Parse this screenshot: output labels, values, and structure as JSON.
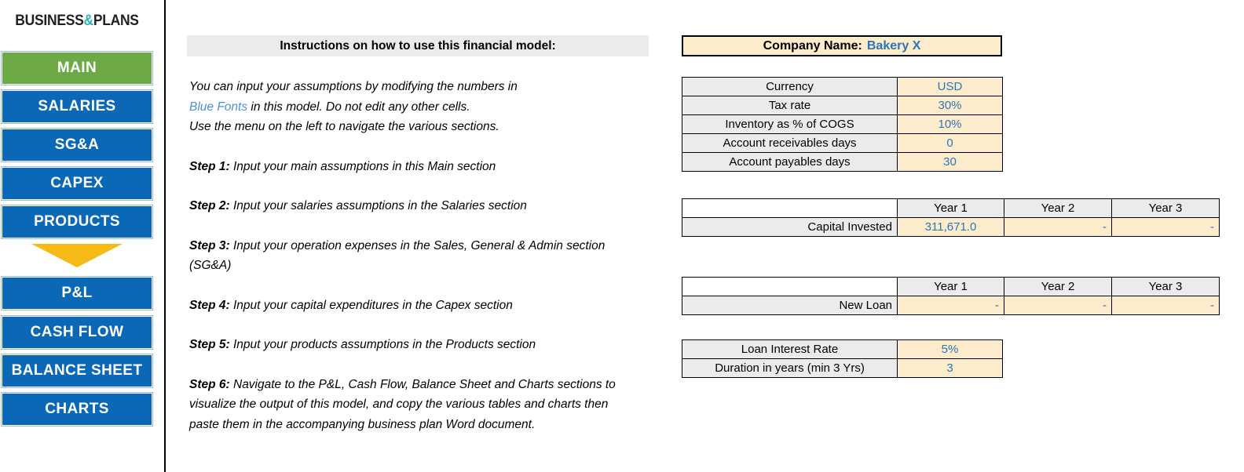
{
  "sidebar": {
    "logo": {
      "part1": "BUSINESS",
      "amp": "&",
      "part2": "PLANS"
    },
    "items": [
      {
        "label": "MAIN",
        "active": true
      },
      {
        "label": "SALARIES",
        "active": false
      },
      {
        "label": "SG&A",
        "active": false
      },
      {
        "label": "CAPEX",
        "active": false
      },
      {
        "label": "PRODUCTS",
        "active": false
      },
      {
        "label": "P&L",
        "active": false
      },
      {
        "label": "CASH FLOW",
        "active": false
      },
      {
        "label": "BALANCE SHEET",
        "active": false
      },
      {
        "label": "CHARTS",
        "active": false
      }
    ],
    "arrow_icon": "down-arrow-icon"
  },
  "instructions": {
    "header": "Instructions on how to use this financial model:",
    "intro_line1_a": "You can input your assumptions by modifying the numbers in",
    "intro_blue": "Blue Fonts",
    "intro_line2_b": " in this model. Do not edit any other cells.",
    "intro_line3": "Use the menu on the left to navigate the various sections.",
    "steps": [
      {
        "label": "Step 1:",
        "text": " Input your main assumptions in this Main section"
      },
      {
        "label": "Step 2:",
        "text": " Input your salaries assumptions in the Salaries section"
      },
      {
        "label": "Step 3:",
        "text": " Input your operation expenses in the Sales, General & Admin section (SG&A)"
      },
      {
        "label": "Step 4:",
        "text": " Input your capital expenditures in the Capex section"
      },
      {
        "label": "Step 5:",
        "text": " Input your products assumptions in the Products section"
      },
      {
        "label": "Step 6:",
        "text": " Navigate to the P&L, Cash Flow, Balance Sheet and Charts sections to visualize the output of this model, and copy the various tables and charts then paste them in the accompanying business plan Word document."
      }
    ]
  },
  "company": {
    "label": "Company Name:",
    "value": "Bakery X"
  },
  "assumptions": {
    "rows": [
      {
        "label": "Currency",
        "value": "USD"
      },
      {
        "label": "Tax rate",
        "value": "30%"
      },
      {
        "label": "Inventory as % of COGS",
        "value": "10%"
      },
      {
        "label": "Account receivables days",
        "value": "0"
      },
      {
        "label": "Account payables days",
        "value": "30"
      }
    ]
  },
  "capital_invested": {
    "headers": [
      "Year 1",
      "Year 2",
      "Year 3"
    ],
    "row_label": "Capital Invested",
    "values": [
      "311,671.0",
      "-",
      "-"
    ]
  },
  "new_loan": {
    "headers": [
      "Year 1",
      "Year 2",
      "Year 3"
    ],
    "row_label": "New Loan",
    "values": [
      "-",
      "-",
      "-"
    ]
  },
  "loan_terms": {
    "rows": [
      {
        "label": "Loan Interest Rate",
        "value": "5%"
      },
      {
        "label": "Duration in years (min 3 Yrs)",
        "value": "3"
      }
    ]
  },
  "colors": {
    "nav_blue": "#0b68b7",
    "nav_active_green": "#6daa46",
    "arrow_yellow": "#f7b916",
    "input_blue_font": "#2e75b6",
    "input_cell_bg": "#fceccb",
    "label_cell_bg": "#ebebeb",
    "logo_teal": "#2fb5b0"
  }
}
